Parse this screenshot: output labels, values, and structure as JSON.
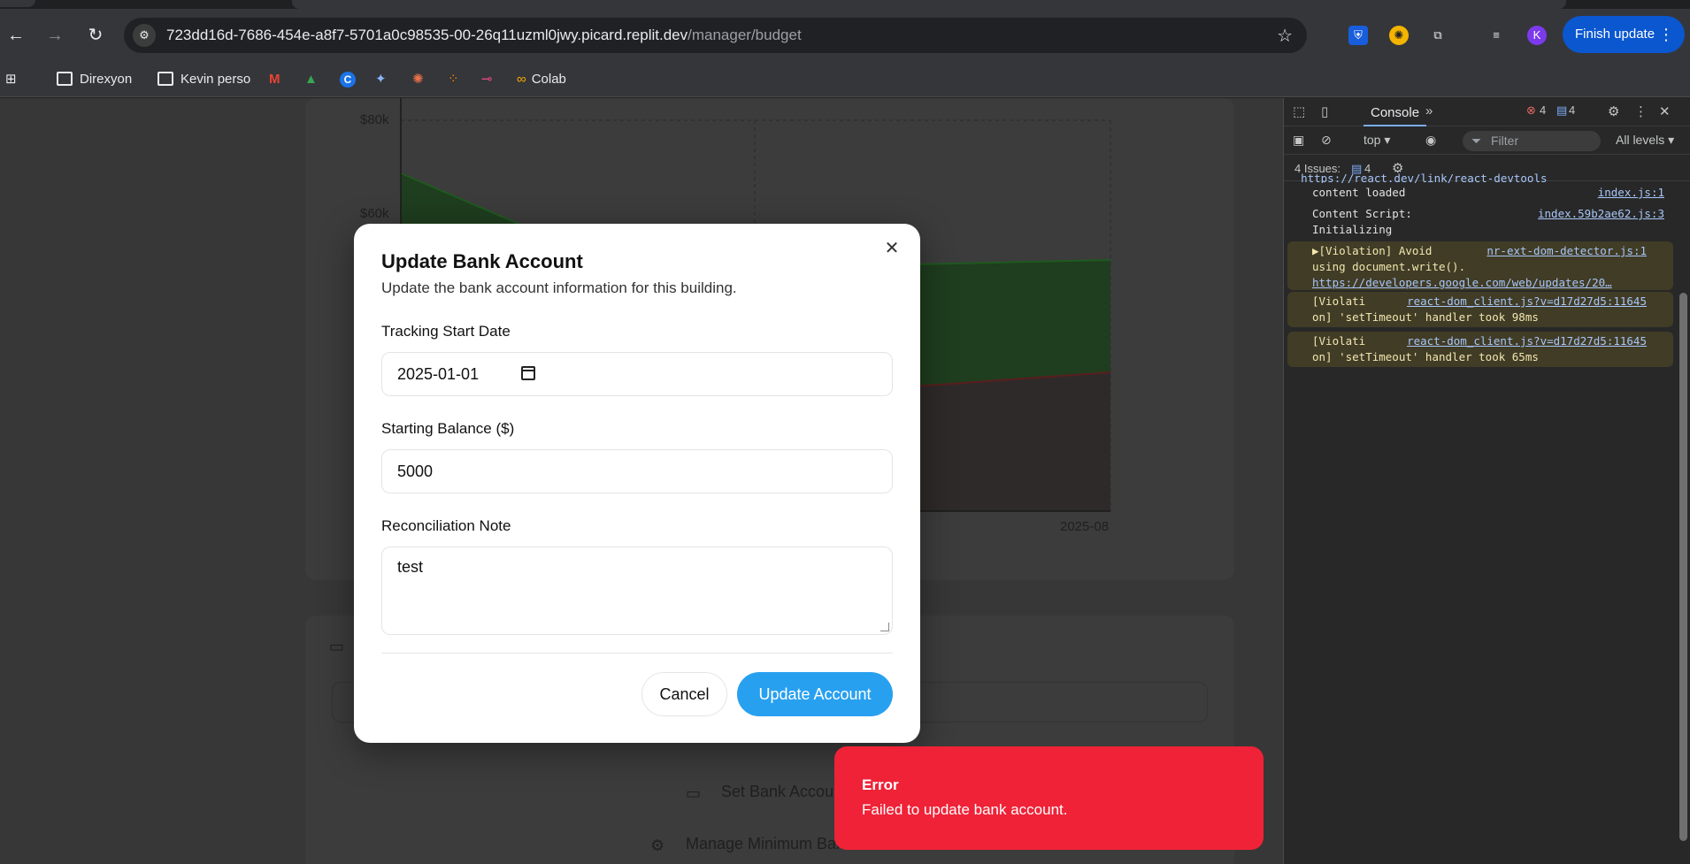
{
  "browser": {
    "url_host": "723dd16d-7686-454e-a8f7-5701a0c98535-00-26q11uzml0jwy.picard.replit.dev",
    "url_path": "/manager/budget",
    "profile_initial": "K",
    "finish_update_label": "Finish update",
    "bookmarks": [
      "Direxyon",
      "Kevin perso",
      "Colab"
    ]
  },
  "page": {
    "chart": {
      "y_ticks": [
        "$80k",
        "$60k"
      ],
      "x_tick": "2025-08"
    },
    "set_bank_account_label": "Set Bank Accou",
    "manage_min_balance_label": "Manage Minimum Balance"
  },
  "dialog": {
    "title": "Update Bank Account",
    "description": "Update the bank account information for this building.",
    "start_date_label": "Tracking Start Date",
    "start_date_value": "2025-01-01",
    "balance_label": "Starting Balance ($)",
    "balance_value": "5000",
    "note_label": "Reconciliation Note",
    "note_value": "test",
    "cancel_label": "Cancel",
    "update_label": "Update Account"
  },
  "toast": {
    "title": "Error",
    "message": "Failed to update bank account."
  },
  "devtools": {
    "console_tab": "Console",
    "error_count": "4",
    "message_count": "4",
    "context": "top",
    "filter_placeholder": "Filter",
    "levels": "All levels",
    "issues_label": "4 Issues:",
    "issues_count": "4",
    "log": [
      {
        "type": "info",
        "text": "content loaded",
        "src": "index.js:1"
      },
      {
        "type": "info",
        "text": "Content Script:\nInitializing",
        "src": "index.59b2ae62.js:3"
      },
      {
        "type": "warn",
        "text": "▶[Violation] Avoid\nusing document.write().",
        "src": "nr-ext-dom-detector.js:1",
        "extra": "https://developers.google.com/web/updates/20…"
      },
      {
        "type": "warn",
        "text": "[Violati\non] 'setTimeout' handler took 98ms",
        "src": "react-dom_client.js?v=d17d27d5:11645"
      },
      {
        "type": "warn",
        "text": "[Violati\non] 'setTimeout' handler took 65ms",
        "src": "react-dom_client.js?v=d17d27d5:11645"
      }
    ]
  }
}
